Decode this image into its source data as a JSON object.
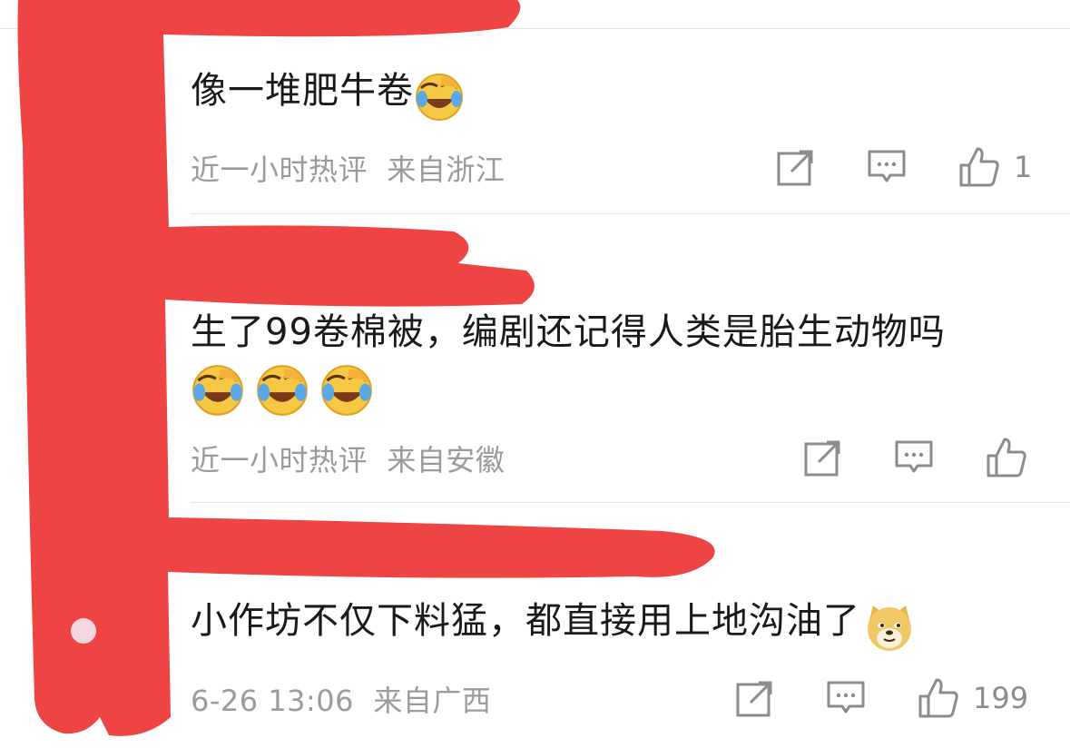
{
  "comments": [
    {
      "text": "像一堆肥牛卷",
      "emojis": [
        "laugh-cry-emoji"
      ],
      "meta_time": "近一小时热评",
      "meta_location": "来自浙江",
      "likes": "1"
    },
    {
      "text": "生了99卷棉被，编剧还记得人类是胎生动物吗",
      "emojis": [
        "laugh-cry-emoji",
        "laugh-cry-emoji",
        "laugh-cry-emoji"
      ],
      "meta_time": "近一小时热评",
      "meta_location": "来自安徽",
      "likes": ""
    },
    {
      "text": "小作坊不仅下料猛，都直接用上地沟油了",
      "emojis": [
        "doge-emoji"
      ],
      "meta_time": "6-26 13:06",
      "meta_location": "来自广西",
      "likes": "199"
    }
  ],
  "icons": {
    "share": "share-icon",
    "comment": "comment-icon",
    "like": "thumbs-up-icon"
  },
  "colors": {
    "redaction": "#ee4444",
    "meta_text": "#9b9b9b",
    "icon": "#8c8c8c"
  }
}
